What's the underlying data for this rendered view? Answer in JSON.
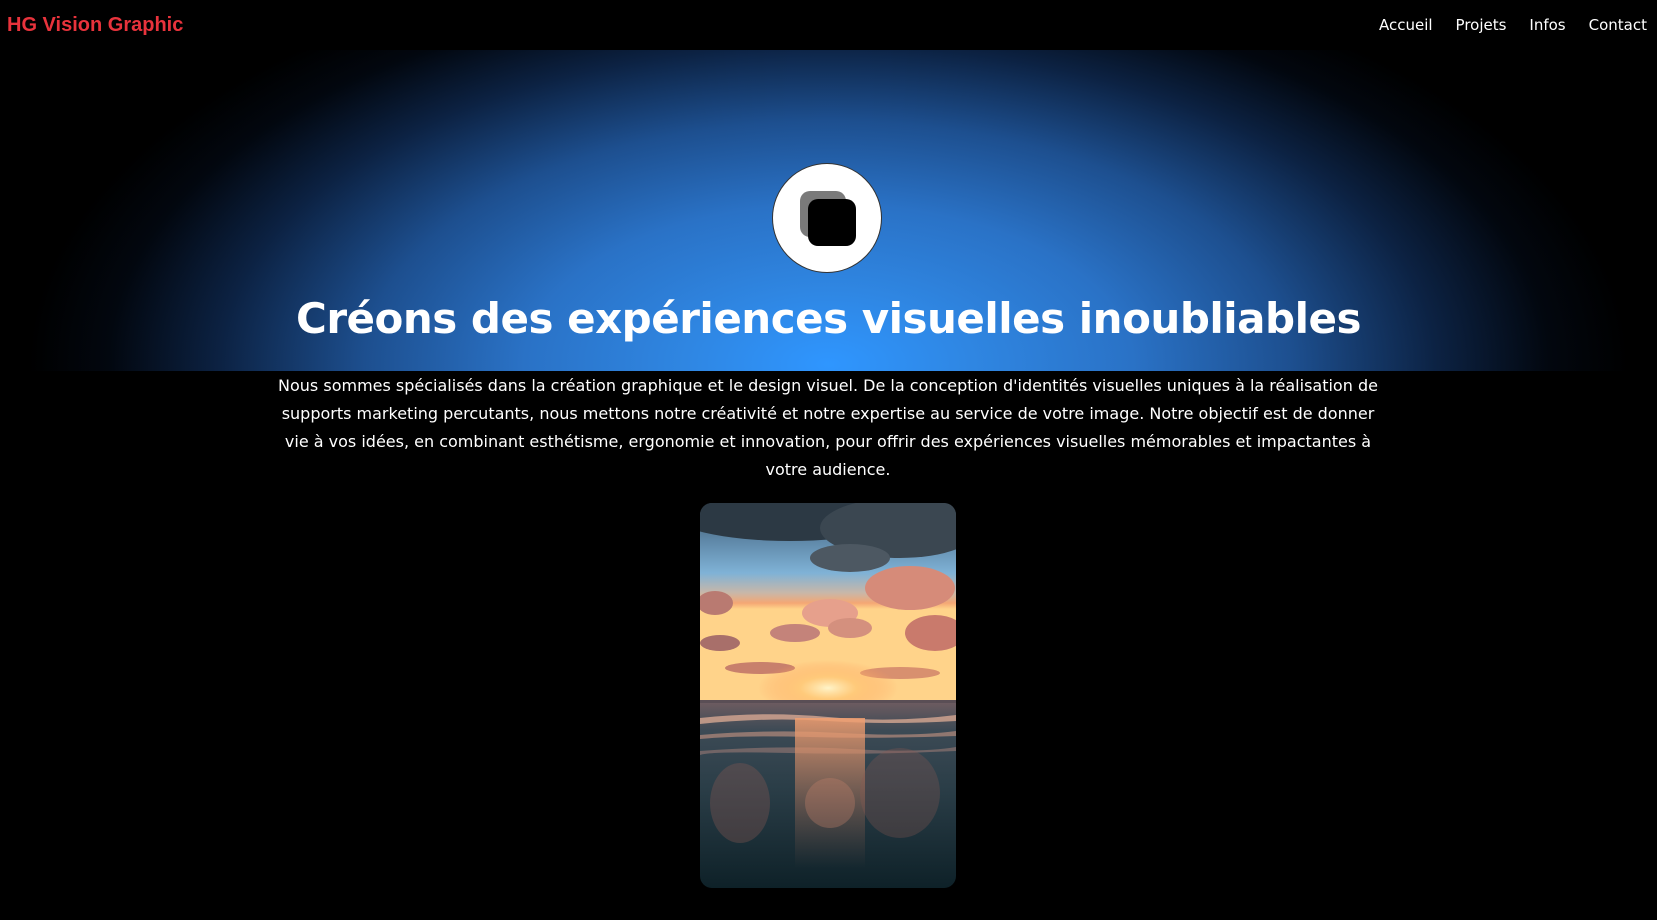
{
  "header": {
    "brand": "HG Vision Graphic",
    "nav": [
      "Accueil",
      "Projets",
      "Infos",
      "Contact"
    ]
  },
  "hero": {
    "title": "Créons des expériences visuelles inoubliables",
    "description": "Nous sommes spécialisés dans la création graphique et le design visuel. De la conception d'identités visuelles uniques à la réalisation de supports marketing percutants, nous mettons notre créativité et notre expertise au service de votre image. Notre objectif est de donner vie à vos idées, en combinant esthétisme, ergonomie et innovation, pour offrir des expériences visuelles mémorables et impactantes à votre audience."
  },
  "colors": {
    "brand": "#e8333c",
    "background": "#000000",
    "hero_center": "#2f96ff",
    "text": "#ffffff"
  },
  "icons": {
    "logo": "stacked-squares-icon"
  }
}
